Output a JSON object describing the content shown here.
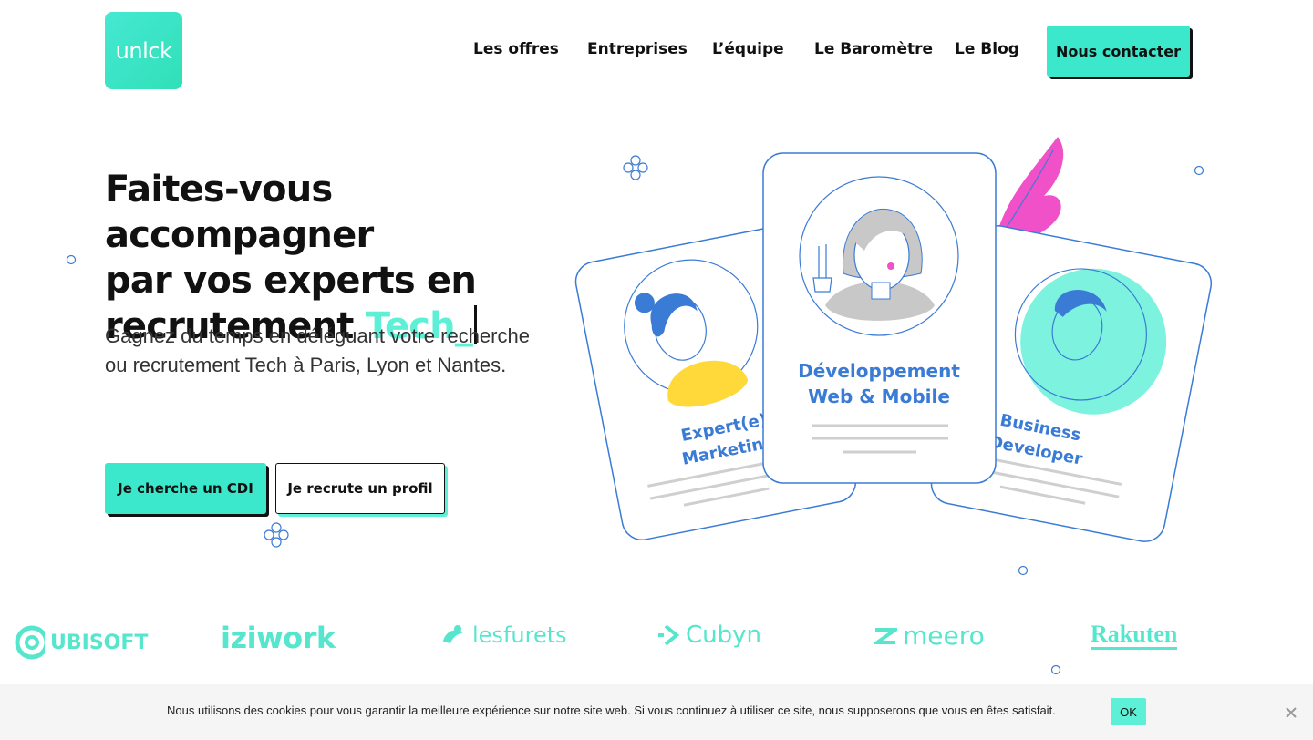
{
  "header": {
    "logo_text": "unlck",
    "nav": [
      "Les offres",
      "Entreprises",
      "L’équipe",
      "Le Baromètre",
      "Le Blog"
    ],
    "cta": "Nous contacter"
  },
  "hero": {
    "title_line1": "Faites-vous accompagner",
    "title_line2": "par vos experts en",
    "title_line3": "recrutement ",
    "title_accent": "Tech_",
    "subtitle": "Gagnez du temps en déléguant votre recherche ou recrutement Tech à Paris, Lyon et Nantes.",
    "btn_primary": "Je cherche un CDI",
    "btn_secondary": "Je recrute un profil"
  },
  "illustration": {
    "card_left_line1": "Expert(e)",
    "card_left_line2": "Marketing",
    "card_center_line1": "Développement",
    "card_center_line2": "Web & Mobile",
    "card_right_line1": "Business",
    "card_right_line2": "Developer"
  },
  "clients": [
    "UBISOFT",
    "iziwork",
    "lesfurets",
    "Cubyn",
    "meero",
    "Rakuten"
  ],
  "cookie": {
    "text": "Nous utilisons des cookies pour vous garantir la meilleure expérience sur notre site web. Si vous continuez à utiliser ce site, nous supposerons que vous en êtes satisfait.",
    "ok": "OK"
  },
  "colors": {
    "accent": "#3ce8cb",
    "accent_light": "#5ef0d6",
    "blue": "#3a7bd5",
    "pink": "#f050c8",
    "yellow": "#ffd93a"
  },
  "icons": [
    "close-icon",
    "ubisoft-swirl-icon",
    "lesfurets-ferret-icon",
    "cubyn-arrow-icon",
    "meero-z-icon"
  ]
}
